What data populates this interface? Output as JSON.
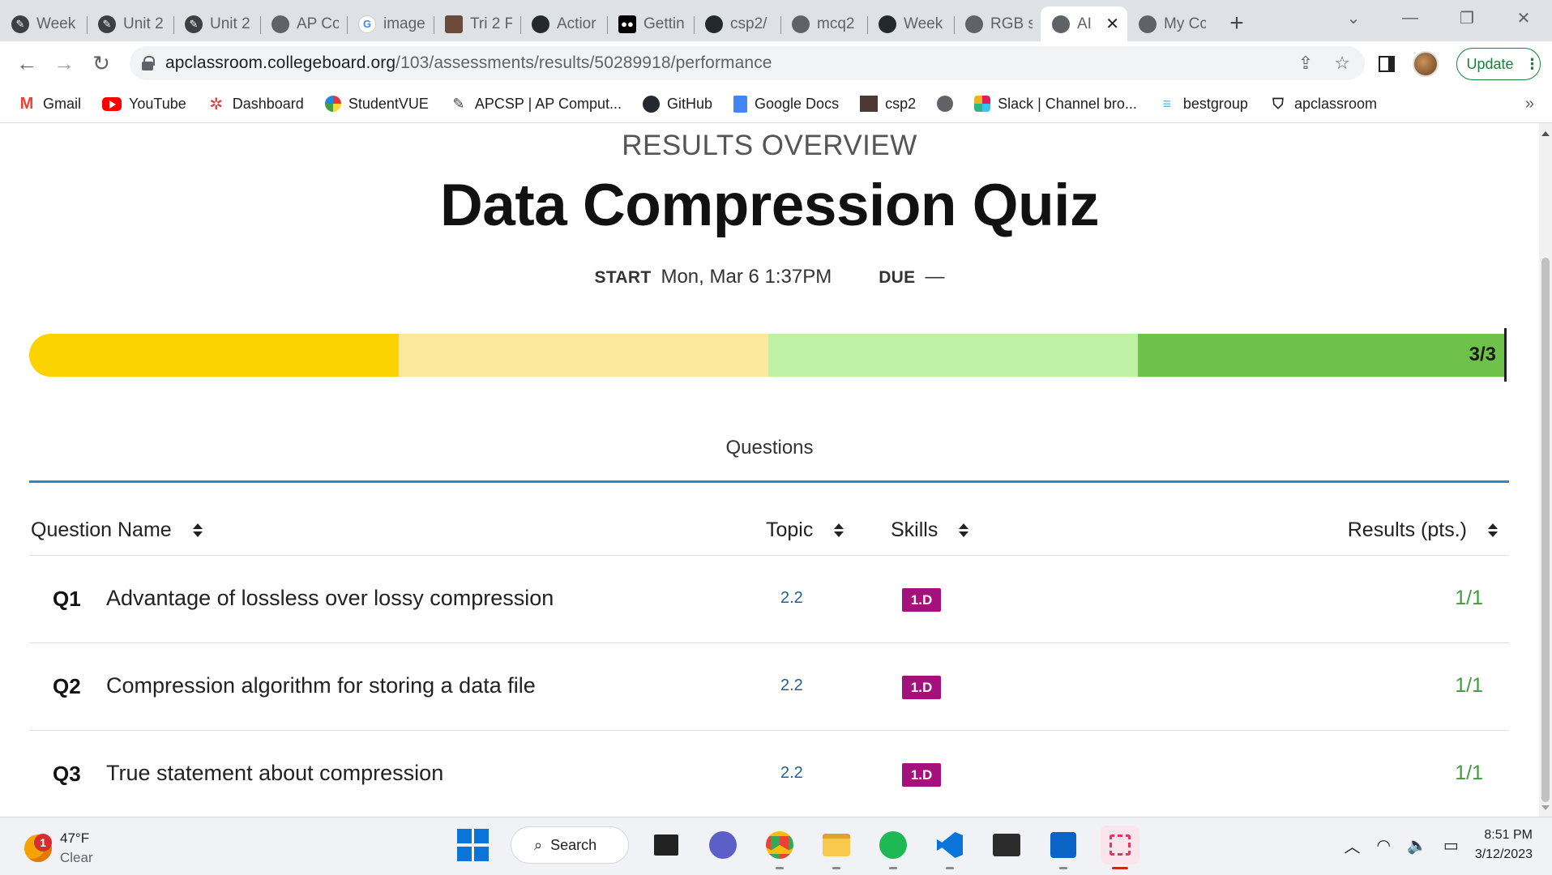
{
  "browser": {
    "tabs": [
      {
        "label": "Week",
        "icon": "ap-classroom-icon"
      },
      {
        "label": "Unit 2",
        "icon": "ap-classroom-icon"
      },
      {
        "label": "Unit 2",
        "icon": "ap-classroom-icon"
      },
      {
        "label": "AP Co",
        "icon": "globe-icon"
      },
      {
        "label": "image",
        "icon": "google-icon"
      },
      {
        "label": "Tri 2 F",
        "icon": "image-icon"
      },
      {
        "label": "Actior",
        "icon": "github-icon"
      },
      {
        "label": "Gettin",
        "icon": "medium-icon"
      },
      {
        "label": "csp2/",
        "icon": "github-icon"
      },
      {
        "label": "mcq2",
        "icon": "globe-icon"
      },
      {
        "label": "Week",
        "icon": "github-icon"
      },
      {
        "label": "RGB s",
        "icon": "globe-icon"
      },
      {
        "label": "AI",
        "icon": "globe-icon",
        "active": true
      },
      {
        "label": "My Cc",
        "icon": "globe-icon"
      }
    ],
    "new_tab": "+",
    "url_host": "apclassroom.collegeboard.org",
    "url_path": "/103/assessments/results/50289918/performance",
    "update_label": "Update",
    "bookmarks": [
      {
        "label": "Gmail",
        "icon": "gmail-icon"
      },
      {
        "label": "YouTube",
        "icon": "youtube-icon"
      },
      {
        "label": "Dashboard",
        "icon": "dashboard-icon"
      },
      {
        "label": "StudentVUE",
        "icon": "studentvue-icon"
      },
      {
        "label": "APCSP | AP Comput...",
        "icon": "ap-classroom-icon"
      },
      {
        "label": "GitHub",
        "icon": "github-icon"
      },
      {
        "label": "Google Docs",
        "icon": "google-docs-icon"
      },
      {
        "label": "csp2",
        "icon": "image-icon"
      },
      {
        "label": "",
        "icon": "globe-icon"
      },
      {
        "label": "Slack | Channel bro...",
        "icon": "slack-icon"
      },
      {
        "label": "bestgroup",
        "icon": "bestgroup-icon"
      },
      {
        "label": "apclassroom",
        "icon": "apclassroom-icon"
      }
    ],
    "more": "»"
  },
  "page": {
    "overline": "RESULTS OVERVIEW",
    "title": "Data Compression Quiz",
    "start_label": "START",
    "start_value": "Mon, Mar 6 1:37PM",
    "due_label": "DUE",
    "due_value": "—",
    "progress_label": "3/3",
    "progress_colors": [
      "#fcd200",
      "#fde8a0",
      "#c0f2a6",
      "#6ec24a"
    ],
    "questions_heading": "Questions",
    "columns": {
      "name": "Question Name",
      "topic": "Topic",
      "skills": "Skills",
      "results": "Results (pts.)"
    },
    "rows": [
      {
        "num": "Q1",
        "name": "Advantage of lossless over lossy compression",
        "topic": "2.2",
        "skill": "1.D",
        "result": "1/1"
      },
      {
        "num": "Q2",
        "name": "Compression algorithm for storing a data file",
        "topic": "2.2",
        "skill": "1.D",
        "result": "1/1"
      },
      {
        "num": "Q3",
        "name": "True statement about compression",
        "topic": "2.2",
        "skill": "1.D",
        "result": "1/1"
      }
    ]
  },
  "taskbar": {
    "weather_temp": "47°F",
    "weather_desc": "Clear",
    "weather_badge": "1",
    "search_label": "Search",
    "time": "8:51 PM",
    "date": "3/12/2023"
  }
}
